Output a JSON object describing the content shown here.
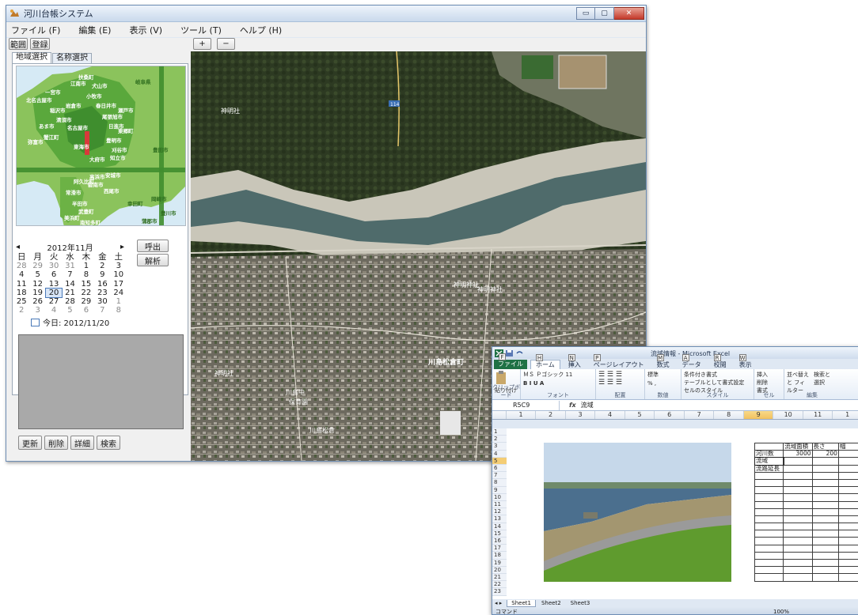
{
  "main_window": {
    "title": "河川台帳システム",
    "controls": {
      "minimize": "▭",
      "maximize": "▢",
      "close": "✕"
    },
    "menu": [
      "ファイル (F)",
      "編集 (E)",
      "表示 (V)",
      "ツール (T)",
      "ヘルプ (H)"
    ],
    "toolbar": {
      "range": "範囲",
      "register": "登録",
      "zoom_in": "+",
      "zoom_out": "−"
    },
    "tabs": {
      "area": "地域選択",
      "name": "名称選択"
    },
    "region_map": {
      "prefecture_label": "岐阜県",
      "labels": [
        "扶桑町",
        "江南市",
        "犬山市",
        "一宮市",
        "北名古屋市",
        "小牧市",
        "春日井市",
        "稲沢市",
        "岩倉市",
        "尾張旭市",
        "瀬戸市",
        "豊明市",
        "清須市",
        "あま市",
        "名古屋市",
        "豊田市",
        "弥富市",
        "蟹江町",
        "東郷町",
        "日進市",
        "刈谷市",
        "大府市",
        "知立市",
        "東海市",
        "安城市",
        "岡崎市",
        "碧南市",
        "西尾市",
        "常滑市",
        "半田市",
        "武豊町",
        "美浜町",
        "南知多町",
        "蒲郡市",
        "幸田町",
        "高浜市",
        "阿久比町",
        "豊川市"
      ],
      "accent_green": "#3f8e2e",
      "light_green": "#8bc35c",
      "water": "#d6eaf5"
    },
    "calendar": {
      "month_label": "2012年11月",
      "prev": "◂",
      "next": "▸",
      "dow": [
        "日",
        "月",
        "火",
        "水",
        "木",
        "金",
        "土"
      ],
      "weeks": [
        [
          "28",
          "29",
          "30",
          "31",
          "1",
          "2",
          "3"
        ],
        [
          "4",
          "5",
          "6",
          "7",
          "8",
          "9",
          "10"
        ],
        [
          "11",
          "12",
          "13",
          "14",
          "15",
          "16",
          "17"
        ],
        [
          "18",
          "19",
          "20",
          "21",
          "22",
          "23",
          "24"
        ],
        [
          "25",
          "26",
          "27",
          "28",
          "29",
          "30",
          "1"
        ],
        [
          "2",
          "3",
          "4",
          "5",
          "6",
          "7",
          "8"
        ]
      ],
      "today_label": "今日: 2012/11/20",
      "selected_day": "20"
    },
    "side_buttons": {
      "call": "呼出",
      "analyze": "解析"
    },
    "bottom_buttons": [
      "更新",
      "削除",
      "詳細",
      "検索"
    ],
    "map_labels": {
      "town": "川島松倉町",
      "shrine1": "神明社",
      "shrine2": "神明社",
      "shrine3": "神明神社",
      "shrine4": "神明神社",
      "school": "川島中",
      "nursery": "保育園",
      "town2": "川島松倉",
      "road_num": "114"
    }
  },
  "excel_window": {
    "title": "流域情報 - Microsoft Excel",
    "tabs": [
      "ファイル",
      "ホーム",
      "挿入",
      "ページレイアウト",
      "数式",
      "データ",
      "校閲",
      "表示"
    ],
    "keytips": [
      "F",
      "H",
      "N",
      "P",
      "M",
      "A",
      "R",
      "W"
    ],
    "ribbon": {
      "paste": "貼り付け",
      "font_name": "ＭＳ Ｐゴシック",
      "font_size": "11",
      "number_format": "標準",
      "cond_format": "条件付き書式",
      "table_format": "テーブルとして書式設定",
      "cell_styles": "セルのスタイル",
      "insert": "挿入",
      "delete": "削除",
      "format": "書式",
      "sort": "並べ替えと フィルター",
      "find": "検索と 選択",
      "groups": [
        "クリップボード",
        "フォント",
        "配置",
        "数値",
        "スタイル",
        "セル",
        "編集"
      ]
    },
    "name_box": "R5C9",
    "fx": "fx",
    "formula_value": "流域",
    "columns": [
      "1",
      "2",
      "3",
      "4",
      "5",
      "6",
      "7",
      "8",
      "9",
      "10",
      "11",
      "1"
    ],
    "selected_column": "9",
    "rows": [
      "1",
      "2",
      "3",
      "4",
      "5",
      "6",
      "7",
      "8",
      "9",
      "10",
      "11",
      "12",
      "13",
      "14",
      "15",
      "16",
      "17",
      "18",
      "19",
      "20",
      "21",
      "22",
      "23"
    ],
    "selected_row": "5",
    "table": {
      "header": [
        "",
        "流域面積",
        "長さ",
        "幅"
      ],
      "r1": [
        "河川数",
        "3000",
        "200",
        ""
      ],
      "r2": [
        "流域",
        "",
        "",
        ""
      ],
      "r3": [
        "流路延長",
        "",
        "",
        ""
      ]
    },
    "sheets": [
      "Sheet1",
      "Sheet2",
      "Sheet3"
    ],
    "status_left": "コマンド",
    "zoom": "100%"
  }
}
